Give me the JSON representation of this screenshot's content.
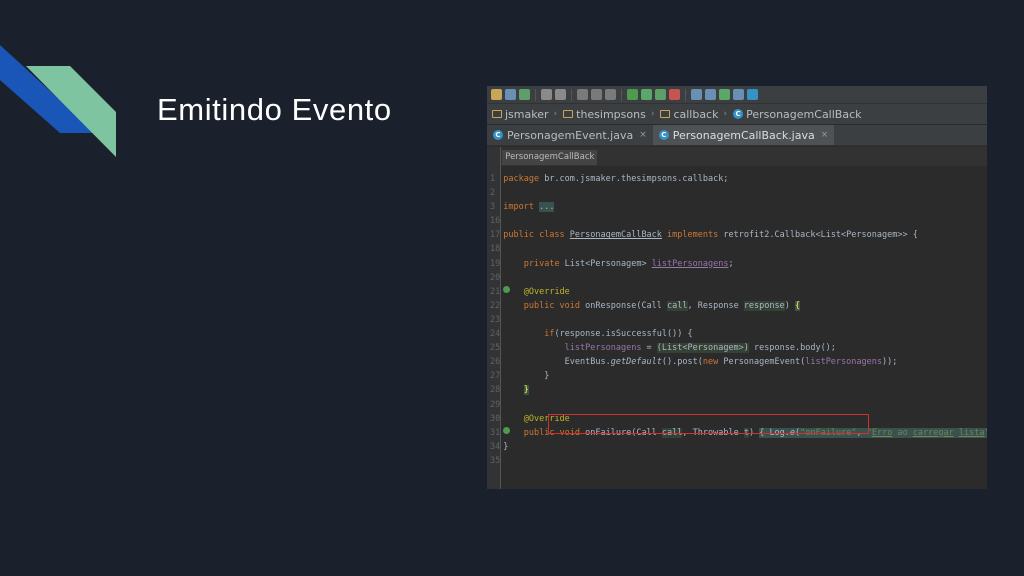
{
  "slide": {
    "title": "Emitindo Evento"
  },
  "colors": {
    "background": "#1a202c",
    "deco_blue": "#1a56b8",
    "deco_green": "#7ec4a0"
  },
  "ide": {
    "navbar": [
      {
        "icon": "folder-icon",
        "label": "jsmaker"
      },
      {
        "icon": "folder-icon",
        "label": "thesimpsons"
      },
      {
        "icon": "folder-icon",
        "label": "callback"
      },
      {
        "icon": "class-icon",
        "label": "PersonagemCallBack"
      }
    ],
    "tabs": [
      {
        "label": "PersonagemEvent.java",
        "close": "×"
      },
      {
        "label": "PersonagemCallBack.java",
        "close": "×"
      }
    ],
    "structure_crumb": "PersonagemCallBack",
    "line_numbers": [
      "1",
      "2",
      "3",
      "16",
      "17",
      "18",
      "19",
      "20",
      "21",
      "22",
      "23",
      "24",
      "25",
      "26",
      "27",
      "28",
      "29",
      "30",
      "31",
      "34",
      "35"
    ]
  }
}
